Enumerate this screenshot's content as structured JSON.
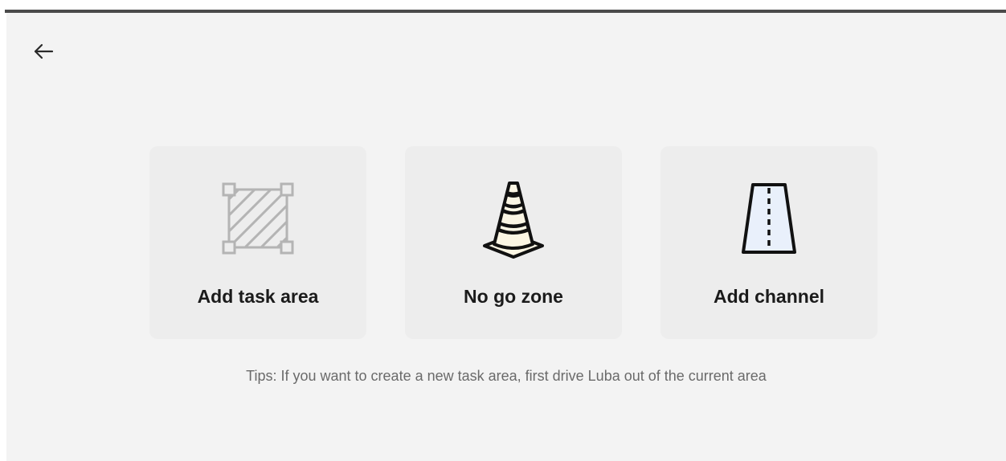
{
  "nav": {
    "back_icon": "arrow-left-icon"
  },
  "options": [
    {
      "label": "Add task area",
      "icon": "task-area-icon",
      "enabled": false
    },
    {
      "label": "No go zone",
      "icon": "traffic-cone-icon",
      "enabled": true
    },
    {
      "label": "Add channel",
      "icon": "channel-road-icon",
      "enabled": true
    }
  ],
  "tips": "Tips: If you want to create a new task area, first drive Luba out of the current area",
  "colors": {
    "background": "#f3f3f3",
    "card": "#ededed",
    "label": "#1b1b1b",
    "disabled_icon": "#b4b4b4",
    "cone_fill": "#fbf6e4",
    "channel_fill": "#e9f0fb"
  }
}
